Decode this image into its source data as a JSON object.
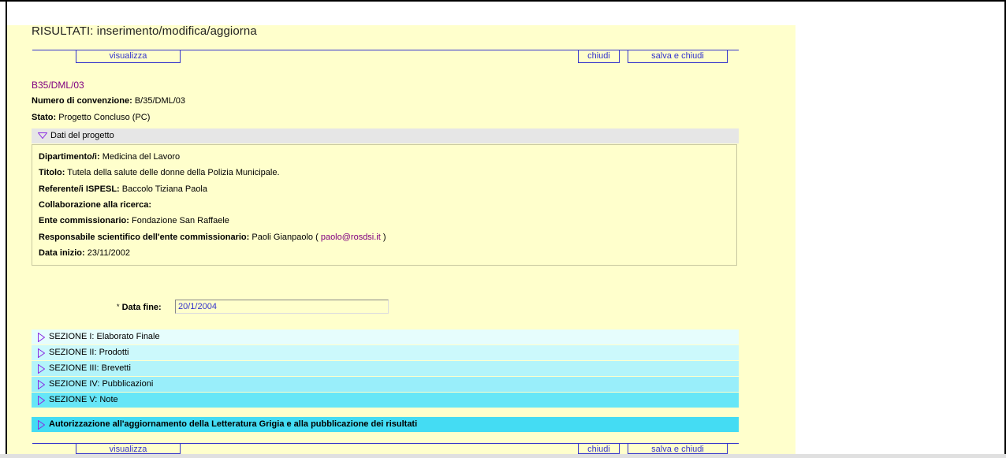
{
  "page": {
    "title": "RISULTATI: inserimento/modifica/aggiorna"
  },
  "toolbar": {
    "view_label": "visualizza",
    "close_label": "chiudi",
    "save_close_label": "salva e chiudi"
  },
  "record": {
    "code": "B35/DML/03",
    "convention_label": "Numero di convenzione:",
    "convention_value": "B/35/DML/03",
    "status_label": "Stato:",
    "status_value": "Progetto Concluso (PC)"
  },
  "project_section": {
    "title": "Dati del progetto",
    "fields": [
      {
        "label": "Dipartimento/i:",
        "value": "Medicina del Lavoro"
      },
      {
        "label": "Titolo:",
        "value": "Tutela della salute delle donne della Polizia Municipale."
      },
      {
        "label": "Referente/i ISPESL:",
        "value": "Baccolo Tiziana Paola"
      },
      {
        "label": "Collaborazione alla ricerca:",
        "value": ""
      },
      {
        "label": "Ente commissionario:",
        "value": "Fondazione San Raffaele"
      },
      {
        "label": "Responsabile scientifico dell'ente commissionario:",
        "value": "Paoli Gianpaolo ("
      },
      {
        "label": "Data inizio:",
        "value": "23/11/2002"
      }
    ],
    "email": "paolo@rosdsi.it",
    "email_close": ")"
  },
  "end_date": {
    "required_mark": "*",
    "label": "Data fine:",
    "value": "20/1/2004"
  },
  "sections": [
    {
      "label": "SEZIONE I: Elaborato Finale",
      "color": "#e6fdfd"
    },
    {
      "label": "SEZIONE II: Prodotti",
      "color": "#ccf9fc"
    },
    {
      "label": "SEZIONE III: Brevetti",
      "color": "#b3f4fa"
    },
    {
      "label": "SEZIONE IV: Pubblicazioni",
      "color": "#99eefa"
    },
    {
      "label": "SEZIONE V: Note",
      "color": "#66e6f7"
    }
  ],
  "authorization": {
    "label": "Autorizzazione all'aggiornamento della Letteratura Grigia e alla pubblicazione dei risultati",
    "color": "#44dcf3"
  },
  "colors": {
    "panel_bg": "#ffffcc",
    "link": "#3333cc",
    "code": "#800080",
    "triangle": "#8a2be2"
  }
}
